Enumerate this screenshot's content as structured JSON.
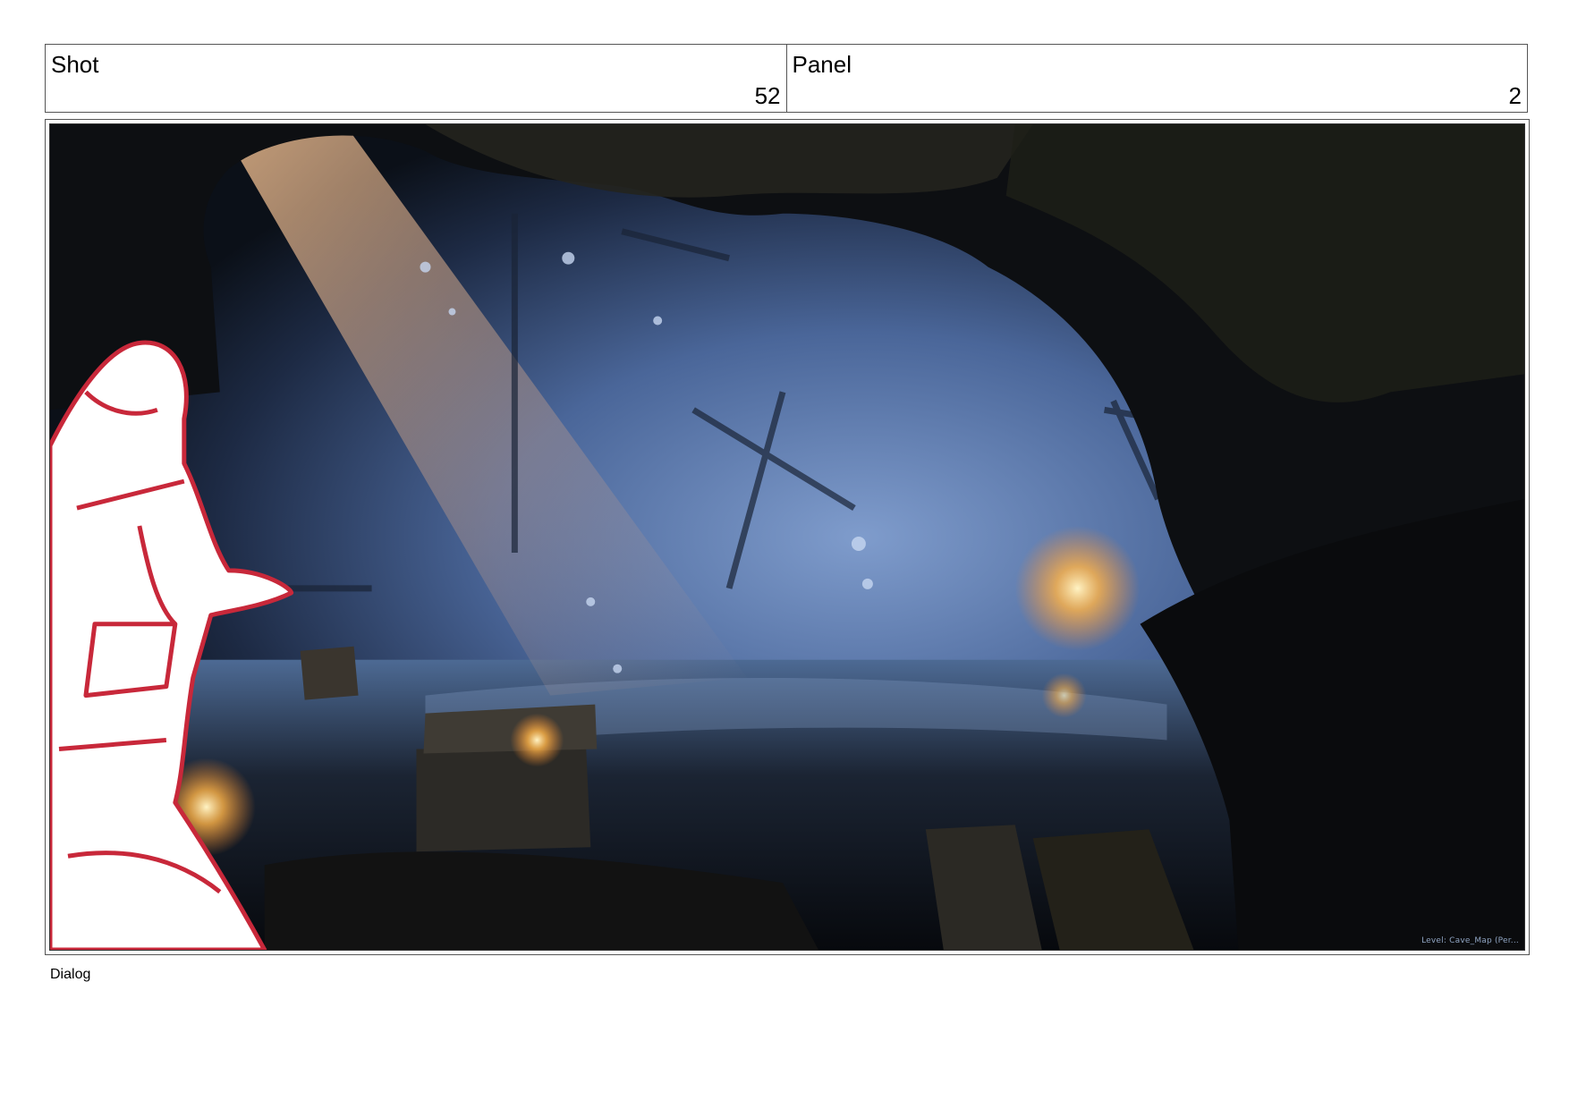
{
  "shot": {
    "label": "Shot",
    "value": "52"
  },
  "panel": {
    "label": "Panel",
    "value": "2"
  },
  "frame": {
    "level_text": "Level:  Cave_Map (Per...",
    "character_sketch_color": "#c8283a",
    "light_color": "#ffcf7a",
    "mist_color": "#6f8fbf"
  },
  "dialog": {
    "label": "Dialog"
  }
}
